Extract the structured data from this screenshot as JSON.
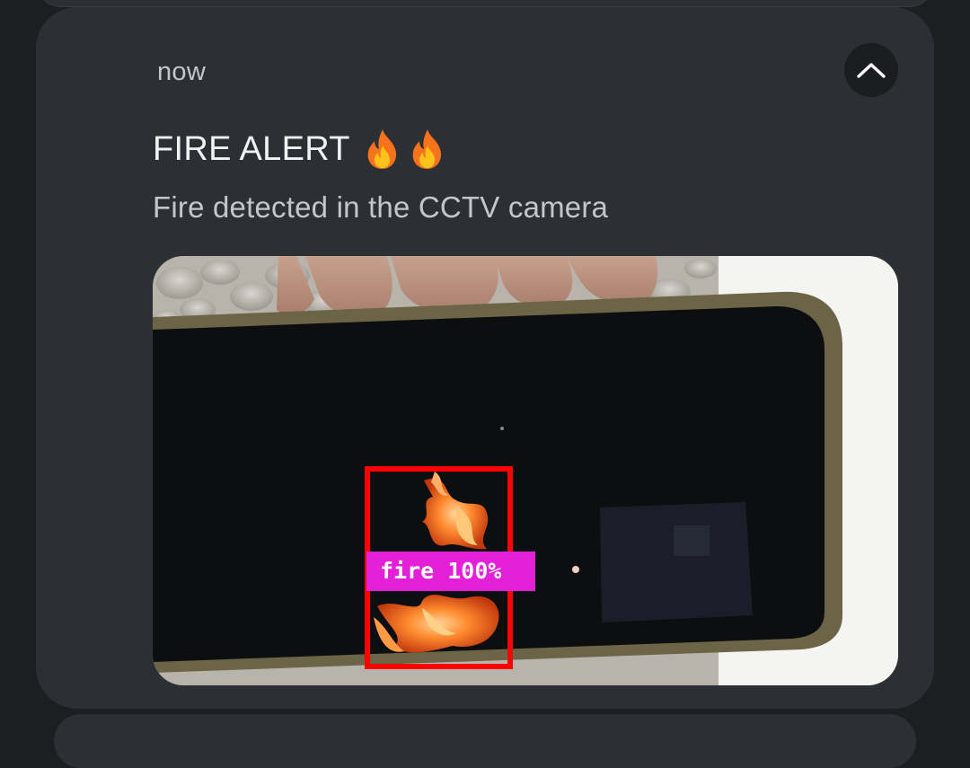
{
  "notification": {
    "timestamp": "now",
    "title": "FIRE ALERT",
    "title_icons": [
      "fire-icon",
      "fire-icon"
    ],
    "body": "Fire detected in the CCTV camera",
    "expand_icon": "chevron-up-icon",
    "image": {
      "description": "camera-snapshot",
      "detection": {
        "label": "fire 100%",
        "box_color": "#ff0000",
        "label_bg_color": "#e31fd8"
      }
    }
  },
  "colors": {
    "background": "#1c1f22",
    "card": "#2c2f33",
    "title_text": "#f1f2f4",
    "secondary_text": "#c3c6ca"
  }
}
